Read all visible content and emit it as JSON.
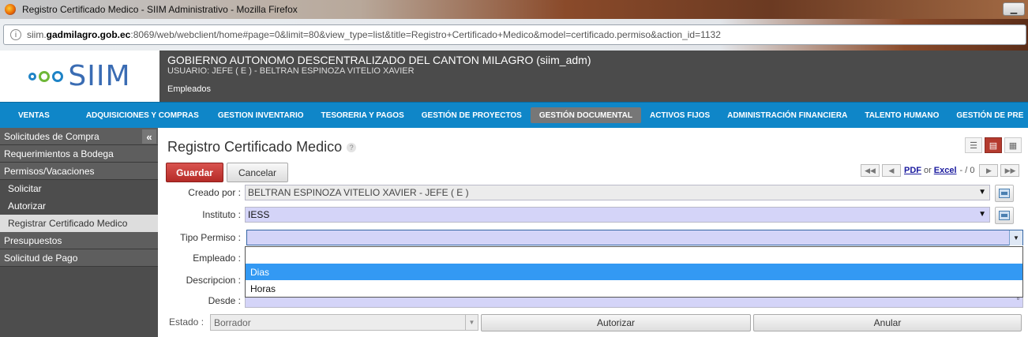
{
  "browser": {
    "title": "Registro Certificado Medico - SIIM Administrativo - Mozilla Firefox",
    "url_prefix": "siim.",
    "url_host": "gadmilagro.gob.ec",
    "url_rest": ":8069/web/webclient/home#page=0&limit=80&view_type=list&title=Registro+Certificado+Medico&model=certificado.permiso&action_id=1132"
  },
  "header": {
    "logo_text": "SIIM",
    "organization": "GOBIERNO AUTONOMO DESCENTRALIZADO DEL CANTON MILAGRO (siim_adm)",
    "user": "USUARIO: JEFE ( E ) - BELTRAN ESPINOZA VITELIO XAVIER",
    "module": "Empleados"
  },
  "menu": {
    "items": [
      {
        "label": "VENTAS"
      },
      {
        "label": "ADQUISICIONES Y COMPRAS"
      },
      {
        "label": "GESTION INVENTARIO"
      },
      {
        "label": "TESORERIA Y PAGOS"
      },
      {
        "label": "GESTIÓN DE PROYECTOS"
      },
      {
        "label": "GESTIÓN DOCUMENTAL",
        "active": true
      },
      {
        "label": "ACTIVOS FIJOS"
      },
      {
        "label": "ADMINISTRACIÓN FINANCIERA"
      },
      {
        "label": "TALENTO HUMANO"
      },
      {
        "label": "GESTIÓN DE PRE"
      }
    ]
  },
  "sidebar": {
    "collapse_icon": "«",
    "items": [
      {
        "label": "Solicitudes de Compra",
        "type": "header"
      },
      {
        "label": "Requerimientos a Bodega",
        "type": "header"
      },
      {
        "label": "Permisos/Vacaciones",
        "type": "header"
      },
      {
        "label": "Solicitar",
        "type": "sub"
      },
      {
        "label": "Autorizar",
        "type": "sub"
      },
      {
        "label": "Registrar Certificado Medico",
        "type": "sub",
        "active": true
      },
      {
        "label": "Presupuestos",
        "type": "header"
      },
      {
        "label": "Solicitud de Pago",
        "type": "header"
      }
    ]
  },
  "main": {
    "title": "Registro Certificado Medico",
    "help": "?",
    "save_label": "Guardar",
    "cancel_label": "Cancelar",
    "pager": {
      "pdf": "PDF",
      "or": "or",
      "excel": "Excel",
      "count": "- / 0"
    }
  },
  "form": {
    "creado_por_label": "Creado por :",
    "creado_por_value": "BELTRAN ESPINOZA VITELIO XAVIER - JEFE ( E )",
    "instituto_label": "Instituto :",
    "instituto_value": "IESS",
    "tipo_permiso_label": "Tipo Permiso :",
    "tipo_permiso_value": "",
    "empleado_label": "Empleado :",
    "descripcion_label": "Descripcion :",
    "desde_label": "Desde :",
    "dropdown_options": [
      "",
      "Dias",
      "Horas"
    ],
    "dropdown_highlighted": "Dias",
    "estado_label": "Estado :",
    "estado_value": "Borrador",
    "autorizar_label": "Autorizar",
    "anular_label": "Anular"
  },
  "colors": {
    "menu_bg": "#0f86c8",
    "save_button": "#c9302c",
    "required_field": "#d4d4f8",
    "dropdown_highlight": "#3399f3"
  }
}
